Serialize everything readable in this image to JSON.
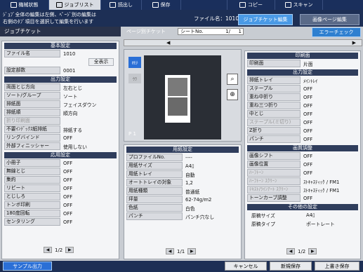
{
  "topbar": {
    "tabs": [
      {
        "label": "機械状態"
      },
      {
        "label": "ジョブリスト"
      },
      {
        "label": "読出し"
      },
      {
        "label": "保存"
      },
      {
        "label": "コピー"
      },
      {
        "label": "スキャン"
      }
    ]
  },
  "header": {
    "message": "ｼﾞｮﾌﾞ全体の編集は左側、ﾍﾟｰｼﾞ別の編集は\n右側のﾀﾌﾞ項目を選択して編集を行います",
    "filename_label": "ファイル名：1010",
    "tab_job_edit": "ジョブチケット編集",
    "tab_image_edit": "画像ページ編集"
  },
  "left": {
    "title": "ジョブチケット",
    "basic": {
      "header": "基本設定",
      "filename_key": "ファイル名",
      "filename_val": "1010",
      "show_all": "全表示",
      "copies_key": "設定部数",
      "copies_val": "0001"
    },
    "output": {
      "header": "出力設定",
      "rows": [
        {
          "key": "両面とじ方向",
          "val": "左右とじ"
        },
        {
          "key": "ソート/グループ",
          "val": "ソート"
        },
        {
          "key": "排紙面",
          "val": "フェイスダウン"
        },
        {
          "key": "排紙順",
          "val": "順方向"
        },
        {
          "key": "折り印刷面",
          "val": ""
        },
        {
          "key": "不要ｲﾝﾃﾞｯｸｽ紙排紙",
          "val": "排紙する"
        },
        {
          "key": "リングバインド",
          "val": "OFF"
        },
        {
          "key": "外部フィニッシャー",
          "val": "使用しない"
        }
      ]
    },
    "applied": {
      "header": "応用設定",
      "rows": [
        {
          "key": "小冊子",
          "val": "OFF"
        },
        {
          "key": "無線とじ",
          "val": "OFF"
        },
        {
          "key": "集約",
          "val": "OFF"
        },
        {
          "key": "リピート",
          "val": "OFF"
        },
        {
          "key": "とじしろ",
          "val": "OFF"
        },
        {
          "key": "トンボ印刷",
          "val": "OFF"
        },
        {
          "key": "180度回転",
          "val": "OFF"
        },
        {
          "key": "センタリング",
          "val": "OFF"
        }
      ]
    },
    "page": "1/2"
  },
  "middle": {
    "title": "ページ別チケット",
    "sheet_label": "シートNo.",
    "sheet_val": "1/",
    "sheet_total": "1",
    "error_check": "エラーチェック",
    "front_label": "ｵﾓﾃ",
    "back_label": "ｳﾗ",
    "page_label": "P  1",
    "paper": {
      "header": "用紙設定",
      "rows": [
        {
          "key": "プロファイルNo.",
          "val": "----"
        },
        {
          "key": "用紙サイズ",
          "val": "A4▯"
        },
        {
          "key": "用紙トレイ",
          "val": "自動"
        },
        {
          "key": "オートトレイの対象",
          "val": "1,2"
        },
        {
          "key": "用紙種類",
          "val": "普通紙"
        },
        {
          "key": "坪量",
          "val": "62-74g/m2"
        },
        {
          "key": "色紙",
          "val": "白色"
        },
        {
          "key": "パンチ",
          "val": "パンチ穴なし"
        }
      ]
    },
    "page": "1/1"
  },
  "right": {
    "print_side": {
      "header": "印刷面",
      "key": "印刷面",
      "val": "片面"
    },
    "output": {
      "header": "出力設定",
      "rows": [
        {
          "key": "排紙トレイ",
          "val": "ﾒｲﾝﾄﾚｲ",
          "dis": false
        },
        {
          "key": "ステープル",
          "val": "OFF",
          "dis": false
        },
        {
          "key": "重ね中折り",
          "val": "OFF",
          "dis": false
        },
        {
          "key": "重ね三つ折り",
          "val": "OFF",
          "dis": false
        },
        {
          "key": "中とじ",
          "val": "OFF",
          "dis": false
        },
        {
          "key": "ステープル(ミ切り)",
          "val": "OFF",
          "dis": true
        },
        {
          "key": "Z折り",
          "val": "OFF",
          "dis": false
        },
        {
          "key": "パンチ",
          "val": "OFF",
          "dis": false
        }
      ]
    },
    "image": {
      "header": "画質調整",
      "rows": [
        {
          "key": "画像シフト",
          "val": "OFF",
          "dis": false
        },
        {
          "key": "画像位置",
          "val": "OFF",
          "dis": false
        },
        {
          "key": "ﾊｰﾌﾄｰﾝ",
          "val": "OFF",
          "dis": true
        },
        {
          "key": "ﾊｰﾌﾄｰﾝ ｽｸﾘｰﾝ",
          "val": "ｽﾄｷｬｽﾃｨｯｸ / FM1",
          "dis": true
        },
        {
          "key": "ﾃｷｽﾄ/ﾗｲﾝｱｰﾄ ｽｸﾘｰﾝ",
          "val": "ｽﾄｷｬｽﾃｨｯｸ / FM1",
          "dis": true
        },
        {
          "key": "トーンカーブ調整",
          "val": "OFF",
          "dis": false
        }
      ]
    },
    "other": {
      "header": "その他の設定",
      "rows": [
        {
          "key": "原稿サイズ",
          "val": "A4▯"
        },
        {
          "key": "原稿タイプ",
          "val": "ポートレート"
        }
      ]
    },
    "page": "1/2"
  },
  "bottom": {
    "sample": "サンプル出力",
    "cancel": "キャンセル",
    "save_new": "新規保存",
    "overwrite": "上書き保存"
  }
}
